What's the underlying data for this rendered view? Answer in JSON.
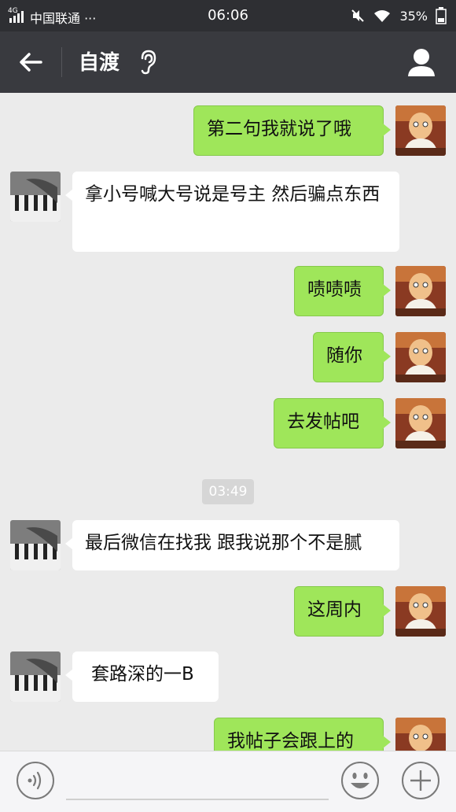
{
  "status_bar": {
    "network_label": "4G",
    "carrier": "中国联通 ···",
    "time": "06:06",
    "battery": "35%"
  },
  "nav": {
    "title": "自渡"
  },
  "chat": {
    "timestamp": "03:49",
    "messages": [
      {
        "side": "out",
        "text": "第二句我就说了哦"
      },
      {
        "side": "in",
        "text": "拿小号喊大号说是号主 然后骗点东西"
      },
      {
        "side": "out",
        "text": "啧啧啧"
      },
      {
        "side": "out",
        "text": "随你"
      },
      {
        "side": "out",
        "text": "去发帖吧"
      },
      {
        "side": "in",
        "text": "最后微信在找我 跟我说那个不是腻"
      },
      {
        "side": "out",
        "text": "这周内"
      },
      {
        "side": "in",
        "text": "套路深的一B"
      },
      {
        "side": "out",
        "text": "我帖子会跟上的"
      }
    ]
  },
  "icons": {
    "back": "arrow-left-icon",
    "ear": "ear-icon",
    "profile": "person-icon",
    "voice": "voice-icon",
    "emoji": "emoji-icon",
    "plus": "plus-icon"
  },
  "colors": {
    "header_bg": "#393a3f",
    "status_bg": "#2e2f33",
    "chat_bg": "#ebebeb",
    "out_bubble": "#9fe65a",
    "in_bubble": "#ffffff"
  }
}
